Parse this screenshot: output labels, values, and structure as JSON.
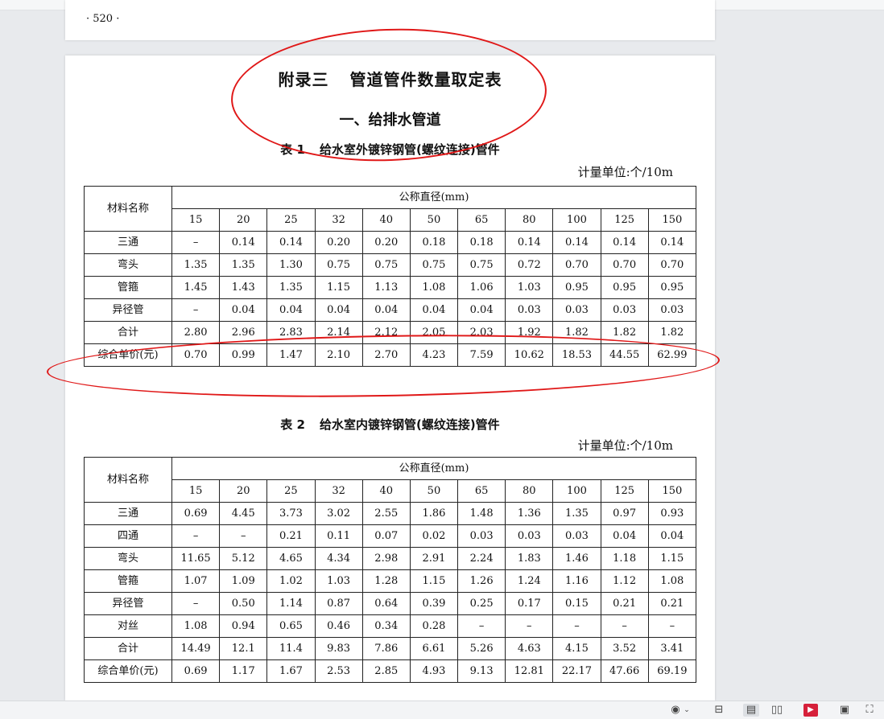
{
  "prev_page": {
    "page_number": "· 520 ·"
  },
  "page": {
    "title_part1": "附录三",
    "title_part2": "管道管件数量取定表",
    "section_title": "一、给排水管道"
  },
  "table1": {
    "caption_num": "表 1",
    "caption_text": "给水室外镀锌钢管(螺纹连接)管件",
    "unit": "计量单位:个/10m",
    "name_header": "材料名称",
    "diameter_header": "公称直径(mm)",
    "diameters": [
      "15",
      "20",
      "25",
      "32",
      "40",
      "50",
      "65",
      "80",
      "100",
      "125",
      "150"
    ],
    "rows": [
      {
        "name": "三通",
        "values": [
          "–",
          "0.14",
          "0.14",
          "0.20",
          "0.20",
          "0.18",
          "0.18",
          "0.14",
          "0.14",
          "0.14",
          "0.14"
        ]
      },
      {
        "name": "弯头",
        "values": [
          "1.35",
          "1.35",
          "1.30",
          "0.75",
          "0.75",
          "0.75",
          "0.75",
          "0.72",
          "0.70",
          "0.70",
          "0.70"
        ]
      },
      {
        "name": "管箍",
        "values": [
          "1.45",
          "1.43",
          "1.35",
          "1.15",
          "1.13",
          "1.08",
          "1.06",
          "1.03",
          "0.95",
          "0.95",
          "0.95"
        ]
      },
      {
        "name": "异径管",
        "values": [
          "–",
          "0.04",
          "0.04",
          "0.04",
          "0.04",
          "0.04",
          "0.04",
          "0.03",
          "0.03",
          "0.03",
          "0.03"
        ]
      },
      {
        "name": "合计",
        "values": [
          "2.80",
          "2.96",
          "2.83",
          "2.14",
          "2.12",
          "2.05",
          "2.03",
          "1.92",
          "1.82",
          "1.82",
          "1.82"
        ]
      },
      {
        "name": "综合单价(元)",
        "values": [
          "0.70",
          "0.99",
          "1.47",
          "2.10",
          "2.70",
          "4.23",
          "7.59",
          "10.62",
          "18.53",
          "44.55",
          "62.99"
        ]
      }
    ]
  },
  "table2": {
    "caption_num": "表 2",
    "caption_text": "给水室内镀锌钢管(螺纹连接)管件",
    "unit": "计量单位:个/10m",
    "name_header": "材料名称",
    "diameter_header": "公称直径(mm)",
    "diameters": [
      "15",
      "20",
      "25",
      "32",
      "40",
      "50",
      "65",
      "80",
      "100",
      "125",
      "150"
    ],
    "rows": [
      {
        "name": "三通",
        "values": [
          "0.69",
          "4.45",
          "3.73",
          "3.02",
          "2.55",
          "1.86",
          "1.48",
          "1.36",
          "1.35",
          "0.97",
          "0.93"
        ]
      },
      {
        "name": "四通",
        "values": [
          "–",
          "–",
          "0.21",
          "0.11",
          "0.07",
          "0.02",
          "0.03",
          "0.03",
          "0.03",
          "0.04",
          "0.04"
        ]
      },
      {
        "name": "弯头",
        "values": [
          "11.65",
          "5.12",
          "4.65",
          "4.34",
          "2.98",
          "2.91",
          "2.24",
          "1.83",
          "1.46",
          "1.18",
          "1.15"
        ]
      },
      {
        "name": "管箍",
        "values": [
          "1.07",
          "1.09",
          "1.02",
          "1.03",
          "1.28",
          "1.15",
          "1.26",
          "1.24",
          "1.16",
          "1.12",
          "1.08"
        ]
      },
      {
        "name": "异径管",
        "values": [
          "–",
          "0.50",
          "1.14",
          "0.87",
          "0.64",
          "0.39",
          "0.25",
          "0.17",
          "0.15",
          "0.21",
          "0.21"
        ]
      },
      {
        "name": "对丝",
        "values": [
          "1.08",
          "0.94",
          "0.65",
          "0.46",
          "0.34",
          "0.28",
          "–",
          "–",
          "–",
          "–",
          "–"
        ]
      },
      {
        "name": "合计",
        "values": [
          "14.49",
          "12.1",
          "11.4",
          "9.83",
          "7.86",
          "6.61",
          "5.26",
          "4.63",
          "4.15",
          "3.52",
          "3.41"
        ]
      },
      {
        "name": "综合单价(元)",
        "values": [
          "0.69",
          "1.17",
          "1.67",
          "2.53",
          "2.85",
          "4.93",
          "9.13",
          "12.81",
          "22.17",
          "47.66",
          "69.19"
        ]
      }
    ]
  },
  "statusbar": {
    "icons": [
      "eye-icon",
      "chevron-down-icon",
      "fit-width-icon",
      "single-page-icon",
      "two-page-icon",
      "play-icon",
      "fit-page-icon",
      "fullscreen-icon"
    ]
  },
  "annotation_color": "#e01818"
}
